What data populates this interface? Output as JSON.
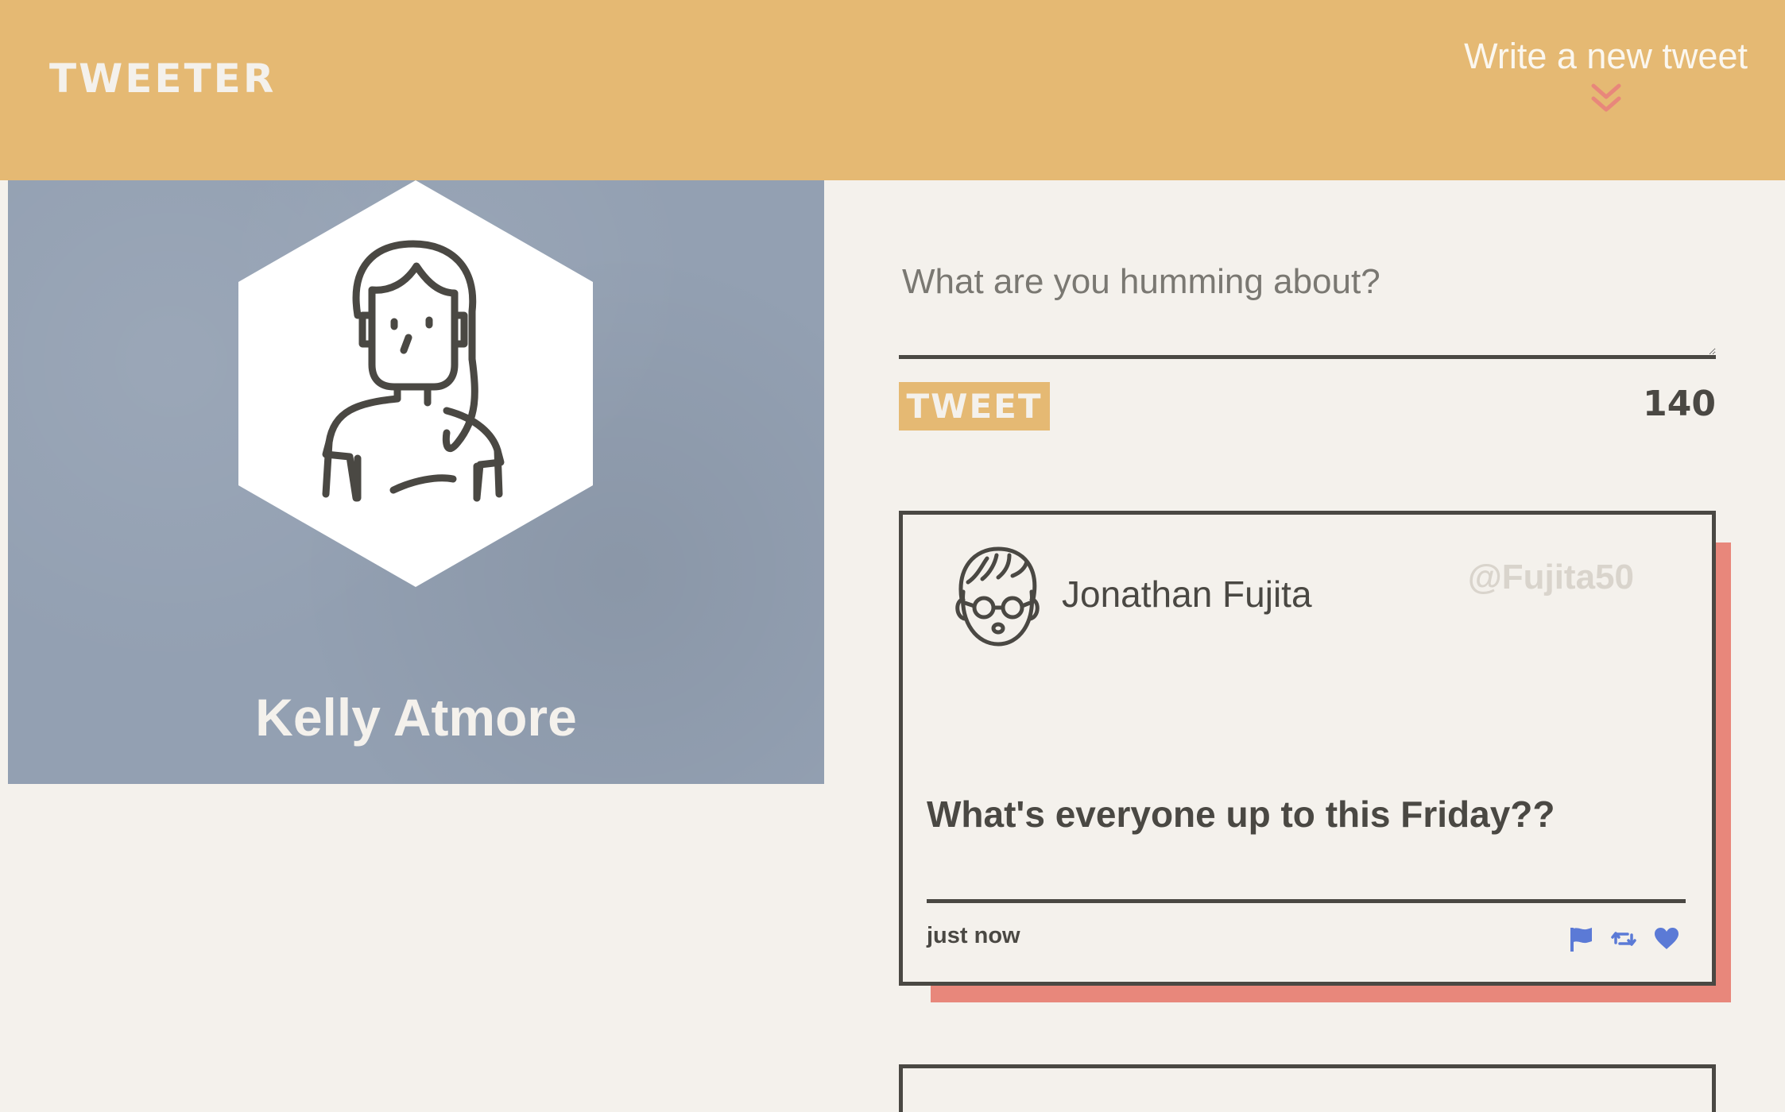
{
  "app": {
    "logo_text": "TWEETER"
  },
  "nav": {
    "compose_label": "Write a new tweet",
    "compose_icon": "double-chevron-down-icon"
  },
  "profile": {
    "name": "Kelly Atmore",
    "avatar_icon": "woman-avatar-icon"
  },
  "composer": {
    "placeholder": "What are you humming about?",
    "value": "",
    "submit_label": "TWEET",
    "char_count": "140"
  },
  "tweets": [
    {
      "author_name": "Jonathan Fujita",
      "handle": "@Fujita50",
      "avatar_icon": "man-with-glasses-avatar-icon",
      "text": "What's everyone up to this Friday??",
      "timestamp": "just now",
      "actions": [
        "flag-icon",
        "retweet-icon",
        "heart-icon"
      ]
    }
  ],
  "colors": {
    "header": "#e5b973",
    "page_background": "#f4f1ec",
    "profile_background": "#93a0b2",
    "card_shadow": "#e8877b",
    "action_icons": "#5b7ad6",
    "text_dark": "#4a4843",
    "handle": "#d9d4cc"
  }
}
